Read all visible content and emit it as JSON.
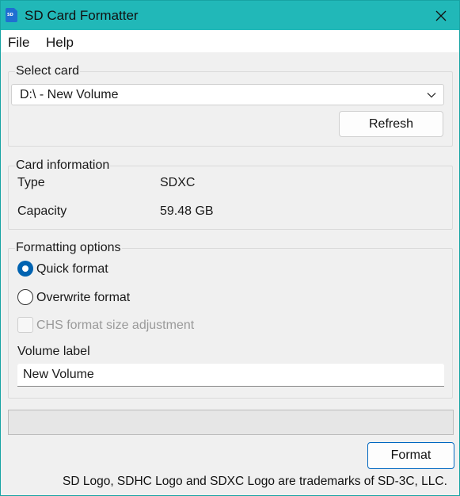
{
  "window": {
    "title": "SD Card Formatter",
    "app_icon_text": "SD"
  },
  "menu": {
    "items": [
      {
        "label": "File"
      },
      {
        "label": "Help"
      }
    ]
  },
  "select_card": {
    "group_title": "Select card",
    "selected_value": "D:\\ - New Volume",
    "refresh_label": "Refresh"
  },
  "card_info": {
    "group_title": "Card information",
    "type_label": "Type",
    "type_value": "SDXC",
    "capacity_label": "Capacity",
    "capacity_value": "59.48 GB"
  },
  "formatting": {
    "group_title": "Formatting options",
    "quick_format": {
      "label": "Quick format",
      "selected": true
    },
    "overwrite_format": {
      "label": "Overwrite format",
      "selected": false
    },
    "chs_adjust": {
      "label": "CHS format size adjustment",
      "checked": false,
      "enabled": false
    },
    "volume_label_title": "Volume label",
    "volume_label_value": "New Volume"
  },
  "progress": {
    "value": 0
  },
  "actions": {
    "format_label": "Format"
  },
  "footer": {
    "trademark_text": "SD Logo, SDHC Logo and SDXC Logo are trademarks of SD-3C, LLC."
  },
  "colors": {
    "titlebar": "#21b8b8",
    "accent": "#0063b1",
    "progress_fill": "#06b025"
  }
}
